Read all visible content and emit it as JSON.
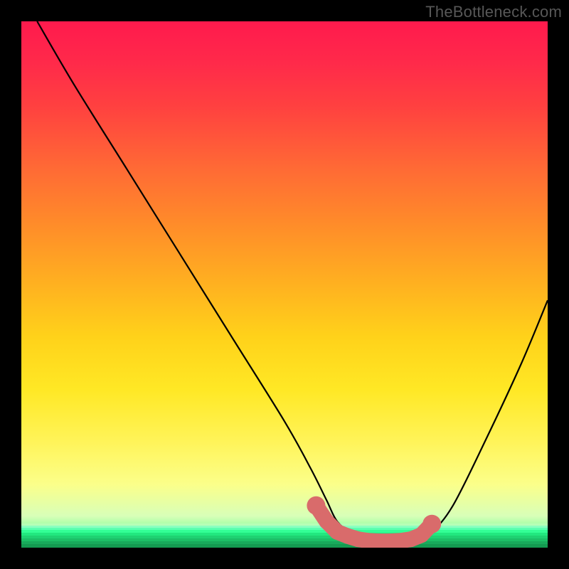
{
  "watermark": "TheBottleneck.com",
  "colors": {
    "frame_bg": "#000000",
    "curve_stroke": "#000000",
    "marker_fill": "#d96b6b",
    "marker_stroke": "#d96b6b"
  },
  "chart_data": {
    "type": "line",
    "title": "",
    "xlabel": "",
    "ylabel": "",
    "xlim": [
      0,
      100
    ],
    "ylim": [
      0,
      100
    ],
    "grid": false,
    "legend": false,
    "series": [
      {
        "name": "curve",
        "x": [
          3,
          10,
          20,
          30,
          40,
          50,
          55,
          58,
          60,
          63,
          66,
          70,
          73,
          75,
          78,
          82,
          88,
          95,
          100
        ],
        "y": [
          100,
          88,
          72,
          56,
          40,
          24,
          15,
          9,
          5,
          2.5,
          1.5,
          1.2,
          1.2,
          1.5,
          3,
          8,
          20,
          35,
          47
        ]
      }
    ],
    "highlight_markers": {
      "x": [
        56,
        58,
        60,
        62,
        64,
        66,
        68,
        70,
        72,
        74,
        76,
        78
      ],
      "y": [
        8,
        5,
        3,
        2.2,
        1.6,
        1.3,
        1.2,
        1.2,
        1.3,
        1.6,
        2.4,
        4.5
      ]
    }
  }
}
